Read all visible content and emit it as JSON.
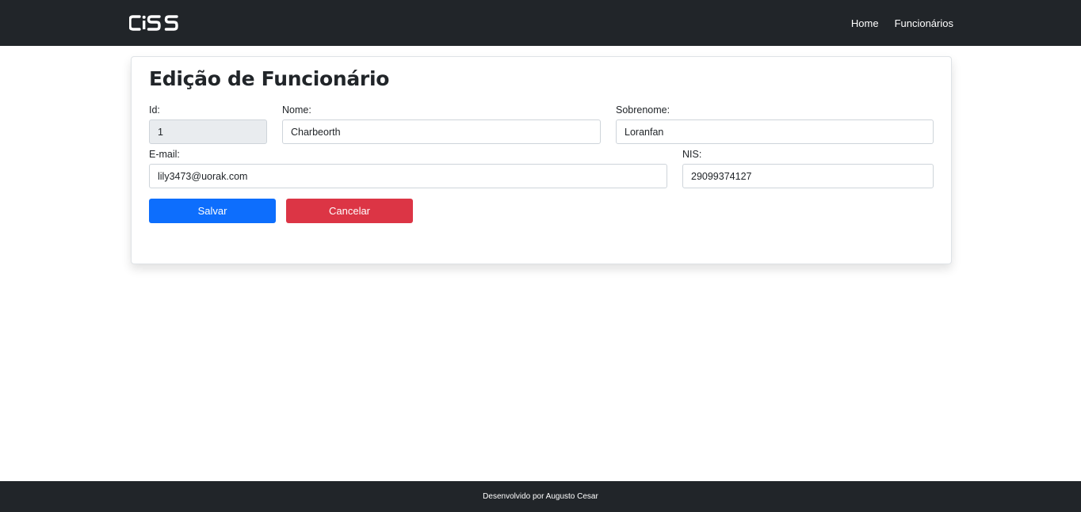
{
  "navbar": {
    "logo_text": "CiSS",
    "links": [
      {
        "label": "Home"
      },
      {
        "label": "Funcionários"
      }
    ]
  },
  "form": {
    "title": "Edição de Funcionário",
    "fields": {
      "id": {
        "label": "Id:",
        "value": "1"
      },
      "nome": {
        "label": "Nome:",
        "value": "Charbeorth"
      },
      "sobrenome": {
        "label": "Sobrenome:",
        "value": "Loranfan"
      },
      "email": {
        "label": "E-mail:",
        "value": "lily3473@uorak.com"
      },
      "nis": {
        "label": "NIS:",
        "value": "29099374127"
      }
    },
    "buttons": {
      "save": "Salvar",
      "cancel": "Cancelar"
    }
  },
  "footer": {
    "text": "Desenvolvido por Augusto Cesar"
  },
  "colors": {
    "navbar_bg": "#212529",
    "primary": "#0d6efd",
    "danger": "#dc3545",
    "readonly_bg": "#e9ecef"
  }
}
